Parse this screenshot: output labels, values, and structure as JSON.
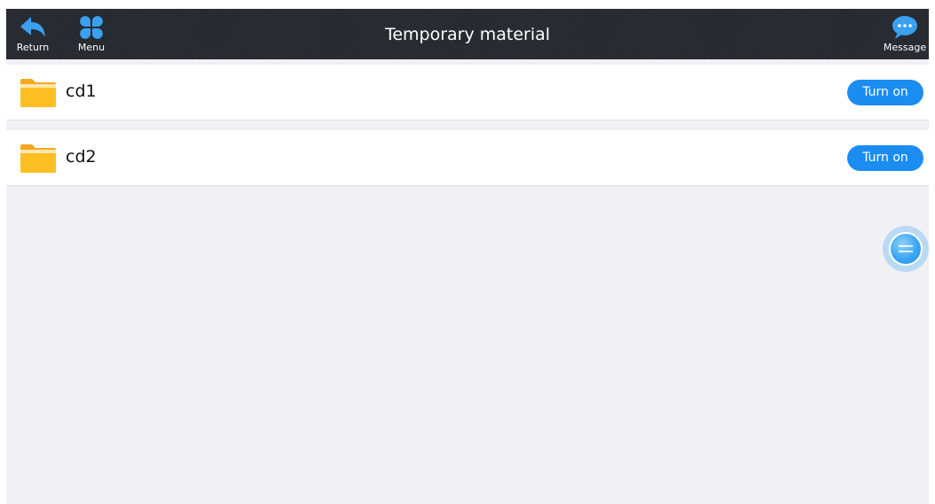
{
  "header": {
    "title": "Temporary material",
    "return_label": "Return",
    "menu_label": "Menu",
    "message_label": "Message",
    "return_icon": "return-arrow-icon",
    "menu_icon": "four-petal-grid-icon",
    "message_icon": "chat-bubble-icon"
  },
  "items": [
    {
      "name": "cd1",
      "action_label": "Turn on",
      "icon": "folder-icon"
    },
    {
      "name": "cd2",
      "action_label": "Turn on",
      "icon": "folder-icon"
    }
  ],
  "floating_button": {
    "icon": "floating-menu-icon"
  },
  "colors": {
    "header_bg": "#23262d",
    "accent": "#1b8cf0",
    "folder": "#fbbf24",
    "background": "#f0f0f5"
  }
}
